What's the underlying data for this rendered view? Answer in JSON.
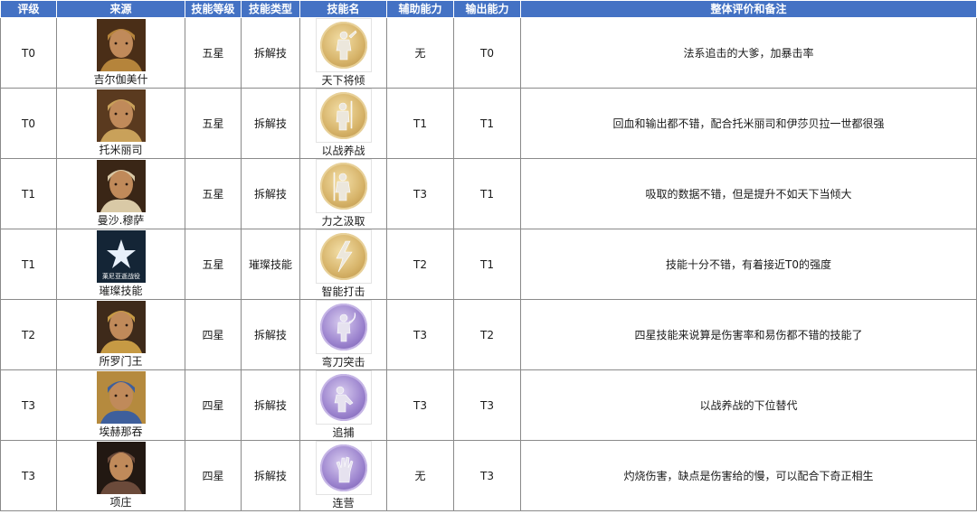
{
  "headers": {
    "rating": "评级",
    "source": "来源",
    "skill_level": "技能等级",
    "skill_type": "技能类型",
    "skill_name": "技能名",
    "support": "辅助能力",
    "output": "输出能力",
    "notes": "整体评价和备注"
  },
  "rows": [
    {
      "rating": "T0",
      "source": "吉尔伽美什",
      "level": "五星",
      "type": "拆解技",
      "skill": "天下将倾",
      "support": "无",
      "output": "T0",
      "note": "法系追击的大爹，加暴击率",
      "icon": "warrior-silhouette-icon",
      "tone": "gold",
      "portrait_colors": [
        "#b5843b",
        "#4a2e17"
      ]
    },
    {
      "rating": "T0",
      "source": "托米丽司",
      "level": "五星",
      "type": "拆解技",
      "skill": "以战养战",
      "support": "T1",
      "output": "T1",
      "note": "回血和输出都不错，配合托米丽司和伊莎贝拉一世都很强",
      "icon": "spear-warrior-icon",
      "tone": "gold",
      "portrait_colors": [
        "#c9a15a",
        "#5a3a1f"
      ]
    },
    {
      "rating": "T1",
      "source": "曼沙.穆萨",
      "level": "五星",
      "type": "拆解技",
      "skill": "力之汲取",
      "support": "T3",
      "output": "T1",
      "note": "吸取的数据不错，但是提升不如天下当倾大",
      "icon": "staff-warrior-icon",
      "tone": "gold",
      "portrait_colors": [
        "#d9c9a6",
        "#3a2616"
      ]
    },
    {
      "rating": "T1",
      "source": "璀璨技能",
      "level": "五星",
      "type": "璀璨技能",
      "skill": "智能打击",
      "support": "T2",
      "output": "T1",
      "note": "技能十分不错，有着接近T0的强度",
      "icon": "lightning-strike-icon",
      "tone": "gold",
      "portrait_colors": [
        "#2f4a66",
        "#142536"
      ],
      "badge_text": "莱尼亚逝战役"
    },
    {
      "rating": "T2",
      "source": "所罗门王",
      "level": "四星",
      "type": "拆解技",
      "skill": "弯刀突击",
      "support": "T3",
      "output": "T2",
      "note": "四星技能来说算是伤害率和易伤都不错的技能了",
      "icon": "scimitar-warrior-icon",
      "tone": "purple",
      "portrait_colors": [
        "#c69a44",
        "#3e2a1a"
      ]
    },
    {
      "rating": "T3",
      "source": "埃赫那吞",
      "level": "四星",
      "type": "拆解技",
      "skill": "追捕",
      "support": "T3",
      "output": "T3",
      "note": "以战养战的下位替代",
      "icon": "hunter-icon",
      "tone": "purple",
      "portrait_colors": [
        "#3e5f9c",
        "#b58a3e"
      ]
    },
    {
      "rating": "T3",
      "source": "项庄",
      "level": "四星",
      "type": "拆解技",
      "skill": "连营",
      "support": "无",
      "output": "T3",
      "note": "灼烧伤害，缺点是伤害给的慢，可以配合下奇正相生",
      "icon": "flame-hand-icon",
      "tone": "purple",
      "portrait_colors": [
        "#6b4a3a",
        "#221812"
      ]
    }
  ]
}
